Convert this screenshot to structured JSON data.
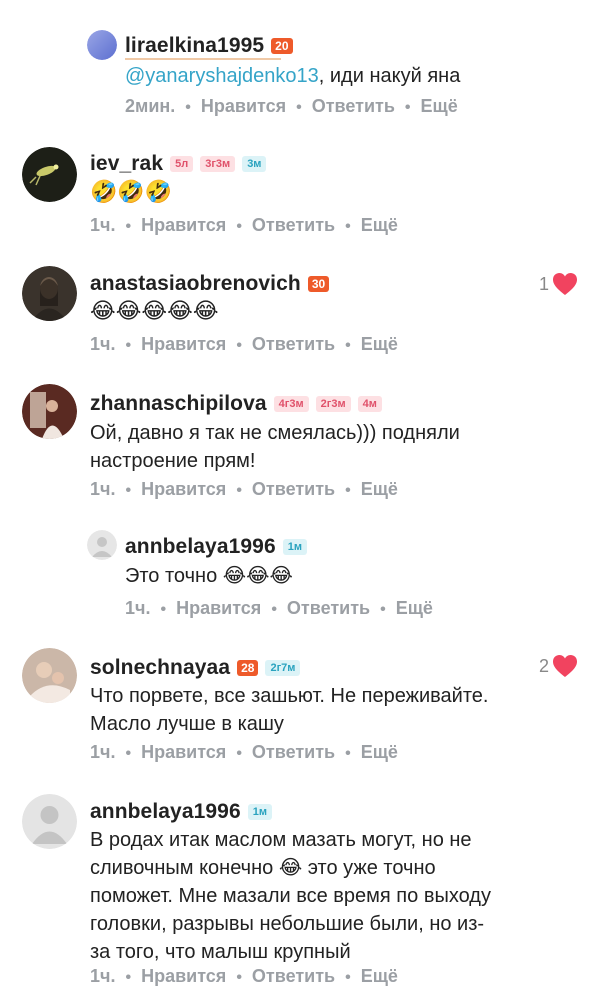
{
  "comments": [
    {
      "username": "liraelkina1995",
      "badges": [
        "20"
      ],
      "mention": "@yanaryshajdenko13",
      "text": ", иди накуй яна",
      "time": "2мин.",
      "like_label": "Нравится",
      "reply_label": "Ответить",
      "more_label": "Ещё"
    },
    {
      "username": "iev_rak",
      "badges": [
        "5л",
        "3г3м",
        "3м"
      ],
      "text": "🤣🤣🤣",
      "time": "1ч.",
      "like_label": "Нравится",
      "reply_label": "Ответить",
      "more_label": "Ещё"
    },
    {
      "username": "anastasiaobrenovich",
      "badges": [
        "30"
      ],
      "text": "😂😂😂😂😂",
      "time": "1ч.",
      "likes": "1",
      "like_label": "Нравится",
      "reply_label": "Ответить",
      "more_label": "Ещё"
    },
    {
      "username": "zhannaschipilova",
      "badges": [
        "4г3м",
        "2г3м",
        "4м"
      ],
      "text_line1": "Ой, давно я так не смеялась))) подняли",
      "text_line2": "настроение прям!",
      "time": "1ч.",
      "like_label": "Нравится",
      "reply_label": "Ответить",
      "more_label": "Ещё"
    },
    {
      "username": "annbelaya1996",
      "badges": [
        "1м"
      ],
      "text": "Это точно 😂😂😂",
      "time": "1ч.",
      "like_label": "Нравится",
      "reply_label": "Ответить",
      "more_label": "Ещё"
    },
    {
      "username": "solnechnayaa",
      "badges": [
        "28",
        "2г7м"
      ],
      "text_line1": "Что порвете, все зашьют. Не переживайте.",
      "text_line2": "Масло лучше в кашу",
      "time": "1ч.",
      "likes": "2",
      "like_label": "Нравится",
      "reply_label": "Ответить",
      "more_label": "Ещё"
    },
    {
      "username": "annbelaya1996",
      "badges": [
        "1м"
      ],
      "text_line1": "В родах итак маслом мазать могут, но не",
      "text_line2": "сливочным конечно 😂 это уже точно",
      "text_line3": "поможет. Мне мазали все время по выходу",
      "text_line4": "головки, разрывы небольшие были, но из-",
      "text_line5": "за того, что малыш крупный",
      "time": "1ч.",
      "like_label": "Нравится",
      "reply_label": "Ответить",
      "more_label": "Ещё"
    }
  ],
  "colors": {
    "badge_orange": "#ee5a2a",
    "badge_pink_text": "#e0526b",
    "badge_blue_text": "#2aa3bf",
    "mention": "#35a4c8",
    "heart": "#f1435f",
    "meta": "#9b9fa4"
  },
  "icons": {
    "heart": "heart-icon",
    "avatar_placeholder": "user-silhouette-icon"
  }
}
